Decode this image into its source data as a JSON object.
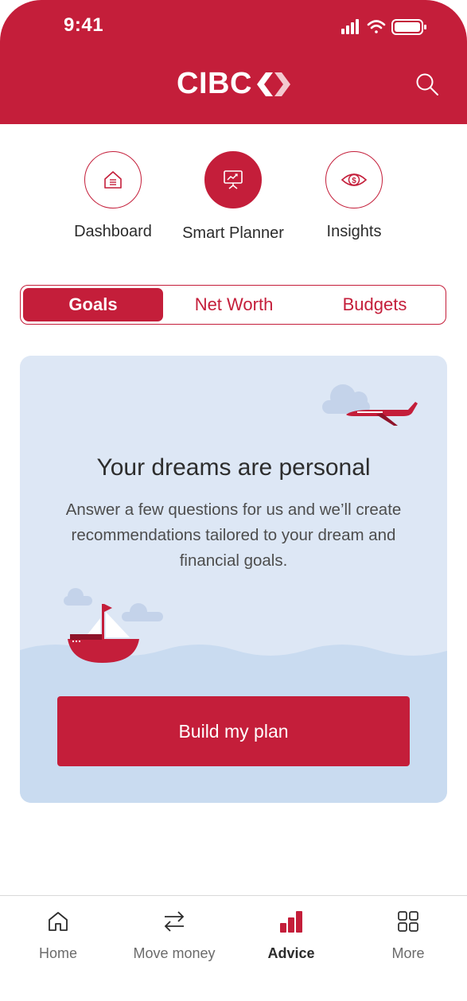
{
  "status_bar": {
    "time": "9:41"
  },
  "header": {
    "logo_text": "CIBC",
    "search_icon": "search-icon"
  },
  "modes": [
    {
      "label": "Dashboard",
      "icon": "house-icon",
      "active": false
    },
    {
      "label": "Smart Planner",
      "icon": "presentation-chart-icon",
      "active": true
    },
    {
      "label": "Insights",
      "icon": "eye-dollar-icon",
      "active": false
    }
  ],
  "segment_tabs": [
    {
      "label": "Goals",
      "active": true
    },
    {
      "label": "Net Worth",
      "active": false
    },
    {
      "label": "Budgets",
      "active": false
    }
  ],
  "card": {
    "title": "Your dreams are personal",
    "body": "Answer a few questions for us and we’ll create recommendations tailored to your dream and financial goals.",
    "button_label": "Build my plan"
  },
  "tab_bar": [
    {
      "label": "Home",
      "icon": "home-icon",
      "active": false
    },
    {
      "label": "Move money",
      "icon": "transfer-arrows-icon",
      "active": false
    },
    {
      "label": "Advice",
      "icon": "bar-chart-icon",
      "active": true
    },
    {
      "label": "More",
      "icon": "grid-icon",
      "active": false
    }
  ],
  "colors": {
    "brand_red": "#c41e3a",
    "card_bg": "#dde7f5",
    "wave": "#c9dbf0"
  }
}
